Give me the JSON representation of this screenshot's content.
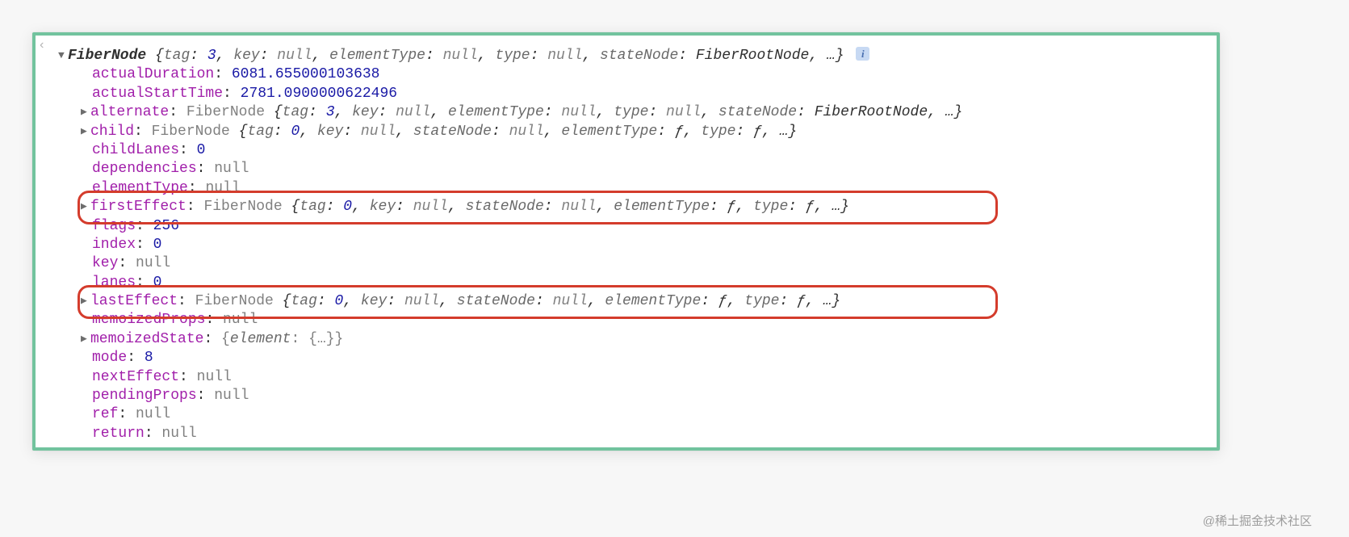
{
  "header": {
    "className": "FiberNode",
    "preview": [
      {
        "k": "tag",
        "v": "3",
        "t": "num"
      },
      {
        "k": "key",
        "v": "null",
        "t": "nul"
      },
      {
        "k": "elementType",
        "v": "null",
        "t": "nul"
      },
      {
        "k": "type",
        "v": "null",
        "t": "nul"
      },
      {
        "k": "stateNode",
        "v": "FiberRootNode",
        "t": "cls"
      }
    ]
  },
  "rows": [
    {
      "key": "actualDuration",
      "val": "6081.655000103638",
      "t": "num"
    },
    {
      "key": "actualStartTime",
      "val": "2781.0900000622496",
      "t": "num"
    },
    {
      "key": "alternate",
      "expand": true,
      "cls": "FiberNode",
      "preview": [
        {
          "k": "tag",
          "v": "3",
          "t": "num"
        },
        {
          "k": "key",
          "v": "null",
          "t": "nul"
        },
        {
          "k": "elementType",
          "v": "null",
          "t": "nul"
        },
        {
          "k": "type",
          "v": "null",
          "t": "nul"
        },
        {
          "k": "stateNode",
          "v": "FiberRootNode",
          "t": "cls"
        }
      ]
    },
    {
      "key": "child",
      "expand": true,
      "cls": "FiberNode",
      "preview": [
        {
          "k": "tag",
          "v": "0",
          "t": "num"
        },
        {
          "k": "key",
          "v": "null",
          "t": "nul"
        },
        {
          "k": "stateNode",
          "v": "null",
          "t": "nul"
        },
        {
          "k": "elementType",
          "v": "ƒ",
          "t": "fn"
        },
        {
          "k": "type",
          "v": "ƒ",
          "t": "fn"
        }
      ]
    },
    {
      "key": "childLanes",
      "val": "0",
      "t": "num"
    },
    {
      "key": "dependencies",
      "val": "null",
      "t": "nul"
    },
    {
      "key": "elementType",
      "val": "null",
      "t": "nul"
    },
    {
      "key": "firstEffect",
      "expand": true,
      "cls": "FiberNode",
      "highlight": true,
      "preview": [
        {
          "k": "tag",
          "v": "0",
          "t": "num"
        },
        {
          "k": "key",
          "v": "null",
          "t": "nul"
        },
        {
          "k": "stateNode",
          "v": "null",
          "t": "nul"
        },
        {
          "k": "elementType",
          "v": "ƒ",
          "t": "fn"
        },
        {
          "k": "type",
          "v": "ƒ",
          "t": "fn"
        }
      ]
    },
    {
      "key": "flags",
      "val": "256",
      "t": "num"
    },
    {
      "key": "index",
      "val": "0",
      "t": "num"
    },
    {
      "key": "key",
      "val": "null",
      "t": "nul"
    },
    {
      "key": "lanes",
      "val": "0",
      "t": "num"
    },
    {
      "key": "lastEffect",
      "expand": true,
      "cls": "FiberNode",
      "highlight": true,
      "preview": [
        {
          "k": "tag",
          "v": "0",
          "t": "num"
        },
        {
          "k": "key",
          "v": "null",
          "t": "nul"
        },
        {
          "k": "stateNode",
          "v": "null",
          "t": "nul"
        },
        {
          "k": "elementType",
          "v": "ƒ",
          "t": "fn"
        },
        {
          "k": "type",
          "v": "ƒ",
          "t": "fn"
        }
      ]
    },
    {
      "key": "memoizedProps",
      "val": "null",
      "t": "nul"
    },
    {
      "key": "memoizedState",
      "expand": true,
      "raw": "{element: {…}}"
    },
    {
      "key": "mode",
      "val": "8",
      "t": "num"
    },
    {
      "key": "nextEffect",
      "val": "null",
      "t": "nul"
    },
    {
      "key": "pendingProps",
      "val": "null",
      "t": "nul"
    },
    {
      "key": "ref",
      "val": "null",
      "t": "nul"
    },
    {
      "key": "return",
      "val": "null",
      "t": "nul"
    }
  ],
  "watermark": "@稀土掘金技术社区"
}
